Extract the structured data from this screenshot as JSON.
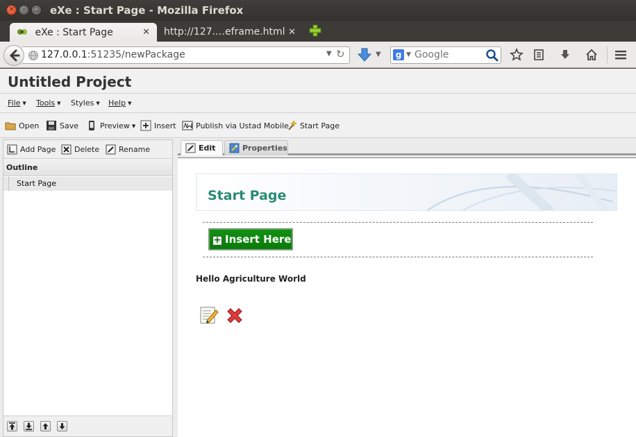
{
  "window": {
    "title": "eXe : Start Page - Mozilla Firefox",
    "controls": [
      "close",
      "minimize",
      "maximize"
    ]
  },
  "browser_tabs": [
    {
      "label": "eXe : Start Page",
      "active": true
    },
    {
      "label": "http://127.…eframe.html",
      "active": false
    }
  ],
  "navigation": {
    "url_host": "127.0.0.1",
    "url_rest": ":51235/newPackage",
    "search_placeholder": "Google"
  },
  "project": {
    "title": "Untitled Project"
  },
  "menu": [
    {
      "label": "File"
    },
    {
      "label": "Tools"
    },
    {
      "label": "Styles"
    },
    {
      "label": "Help"
    }
  ],
  "toolbar": {
    "open": "Open",
    "save": "Save",
    "preview": "Preview",
    "insert": "Insert",
    "publish": "Publish via Ustad Mobile",
    "start_page": "Start Page"
  },
  "outline_panel": {
    "add_page": "Add Page",
    "delete": "Delete",
    "rename": "Rename",
    "header": "Outline",
    "items": [
      "Start Page"
    ]
  },
  "editor_tabs": {
    "edit": "Edit",
    "properties": "Properties"
  },
  "editor": {
    "page_heading": "Start Page",
    "insert_button": "Insert Here",
    "idevice_text": "Hello Agriculture World"
  },
  "colors": {
    "heading": "#2a8a76",
    "insert_button": "#0f870f",
    "titlebar": "#3c3b37"
  }
}
